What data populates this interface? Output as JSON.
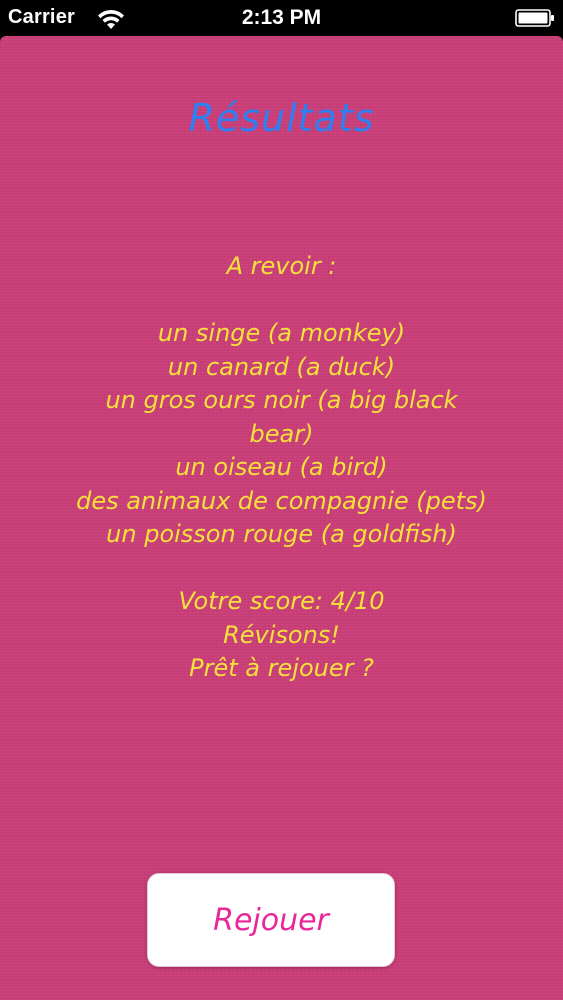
{
  "status_bar": {
    "carrier": "Carrier",
    "time": "2:13 PM",
    "wifi_icon": "wifi-icon",
    "battery_icon": "battery-icon"
  },
  "colors": {
    "background": "#c93e78",
    "title": "#2f7ff2",
    "text": "#f4e23a",
    "button_text": "#e8279a"
  },
  "title": "Résultats",
  "review": {
    "heading": "A revoir :",
    "items": [
      "un singe (a monkey)",
      "un canard (a duck)",
      "un gros ours noir (a big black",
      "bear)",
      "un oiseau (a bird)",
      "des animaux de compagnie (pets)",
      "un poisson rouge (a goldfish)"
    ]
  },
  "score": {
    "label": "Votre score: 4/10",
    "message": "Révisons!",
    "prompt": "Prêt à rejouer ?"
  },
  "replay_button": {
    "label": "Rejouer"
  }
}
